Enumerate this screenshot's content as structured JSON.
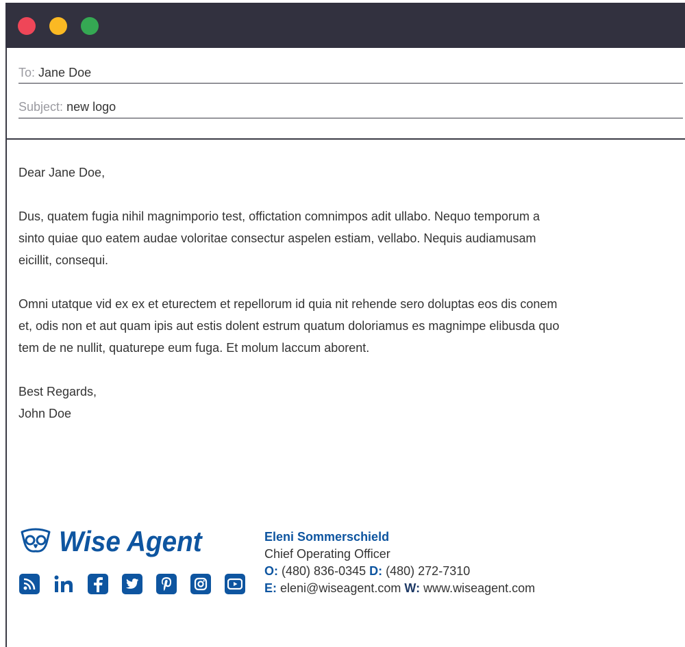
{
  "window": {
    "controls": [
      "close",
      "minimize",
      "maximize"
    ],
    "colors": {
      "close": "#ef4658",
      "minimize": "#fbb923",
      "maximize": "#35a853",
      "titlebar": "#32313f"
    }
  },
  "email": {
    "to_label": "To:",
    "to_value": "Jane Doe",
    "subject_label": "Subject:",
    "subject_value": "new logo",
    "greeting": "Dear Jane Doe,",
    "paragraphs": [
      "Dus, quatem fugia nihil magnimporio test, offictation comnimpos adit ullabo. Nequo temporum a sinto quiae quo eatem audae voloritae consectur aspelen estiam, vellabo. Nequis audiamusam eicillit, consequi.",
      "Omni utatque vid ex ex et eturectem et repellorum id quia nit rehende sero doluptas eos dis conem et, odis non et aut quam ipis aut estis dolent estrum quatum doloriamus es magnimpe elibusda quo tem de ne nullit, quaturepe eum fuga. Et molum laccum aborent."
    ],
    "closing": "Best Regards,",
    "sender": "John Doe"
  },
  "signature": {
    "logo_text": "Wise Agent",
    "brand_color": "#0e55a0",
    "social_icons": [
      "rss-icon",
      "linkedin-icon",
      "facebook-icon",
      "twitter-icon",
      "pinterest-icon",
      "instagram-icon",
      "youtube-icon"
    ],
    "name": "Eleni Sommerschield",
    "title": "Chief Operating Officer",
    "office_label": "O:",
    "office_phone": "(480) 836-0345",
    "direct_label": "D:",
    "direct_phone": "(480) 272-7310",
    "email_label": "E:",
    "email": "eleni@wiseagent.com",
    "web_label": "W:",
    "website": "www.wiseagent.com"
  }
}
